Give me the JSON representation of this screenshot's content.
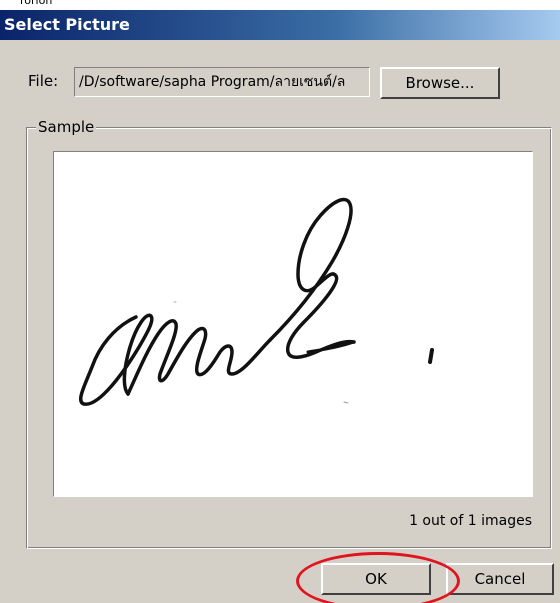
{
  "window": {
    "title": "Select Picture",
    "top_cut_text": "rorion"
  },
  "file": {
    "label": "File:",
    "path": "/D/software/sapha Program/ลายเซนต์/ล",
    "browse_label": "Browse..."
  },
  "sample": {
    "legend": "Sample",
    "image_name": "signature-image",
    "counter": "1 out of 1 images"
  },
  "buttons": {
    "ok": "OK",
    "cancel": "Cancel"
  },
  "colors": {
    "titlebar_start": "#0a246a",
    "titlebar_end": "#a6caf0",
    "dialog_bg": "#d4d0c8",
    "annotation_ring": "#e0141e"
  }
}
